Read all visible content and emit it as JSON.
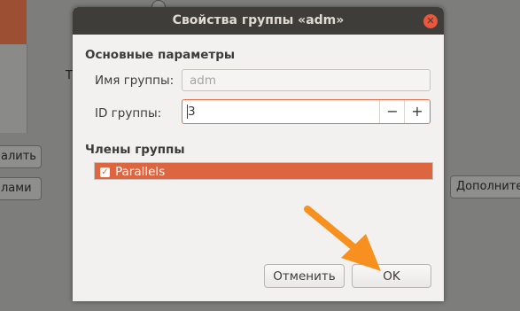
{
  "background": {
    "delete_button_label": "алить",
    "groups_button_label": "лами",
    "more_button_label": "Дополните",
    "side_letter": "Т"
  },
  "dialog": {
    "title": "Свойства группы «adm»",
    "close_icon": "close-icon",
    "main_section_title": "Основные параметры",
    "group_name_label": "Имя группы:",
    "group_name_value": "adm",
    "group_id_label": "ID группы:",
    "group_id_value": "3",
    "decrement_label": "−",
    "increment_label": "+",
    "members_section_title": "Члены группы",
    "members": [
      {
        "name": "Parallels",
        "checked": true
      }
    ],
    "cancel_label": "Отменить",
    "ok_label": "OK"
  },
  "colors": {
    "accent": "#dd6641",
    "titlebar": "#3e3d39",
    "arrow": "#f7901e"
  }
}
